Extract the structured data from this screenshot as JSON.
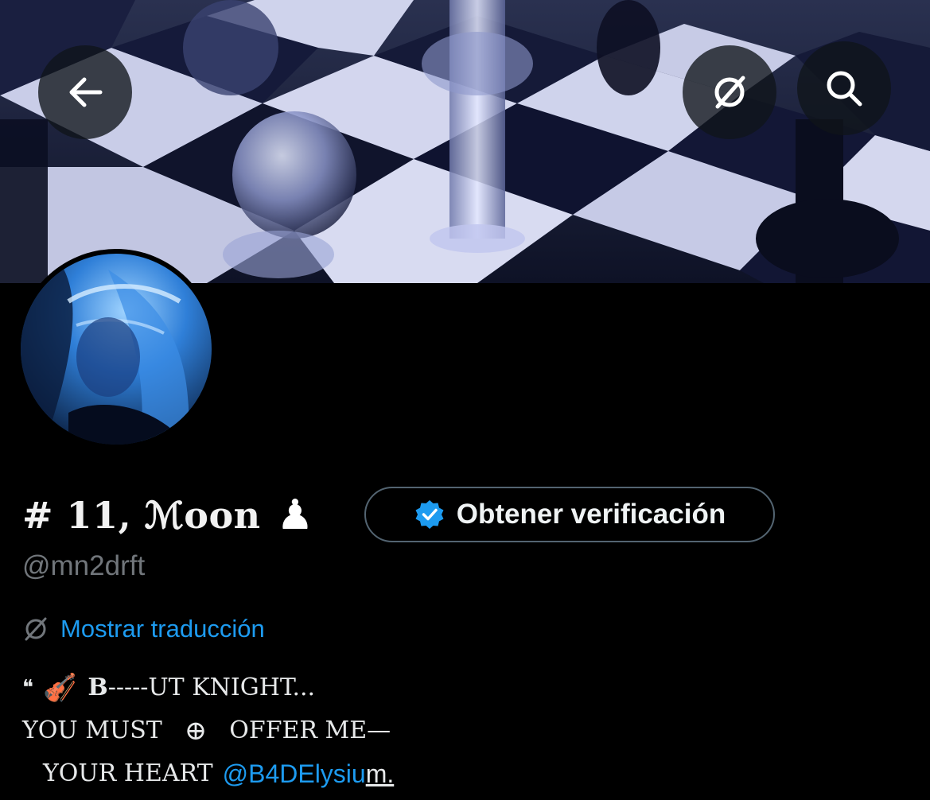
{
  "profile": {
    "display_name": "# 11, ℳoon",
    "name_emoji": "♟",
    "handle": "@mn2drft",
    "verify_button_label": "Obtener verificación",
    "translate_link": "Mostrar traducción"
  },
  "bio": {
    "quote_mark": "❝",
    "emoji": "🎻",
    "line1_b": "B",
    "line1_rest": "-----UT KNIGHT...",
    "line2_part1": "YOU MUST",
    "crosshair": "⊕",
    "line2_part2": "OFFER ME—",
    "line3_text": "YOUR HEART",
    "mention": "@B4DElysiu",
    "mention_tail": "m."
  },
  "colors": {
    "background": "#000000",
    "link": "#1d9bf0",
    "handle": "#71767b",
    "verified_badge": "#1d9bf0"
  },
  "icons": {
    "back": "arrow-left-icon",
    "translate": "translate-icon",
    "search": "search-icon",
    "verified": "verified-badge-icon"
  }
}
